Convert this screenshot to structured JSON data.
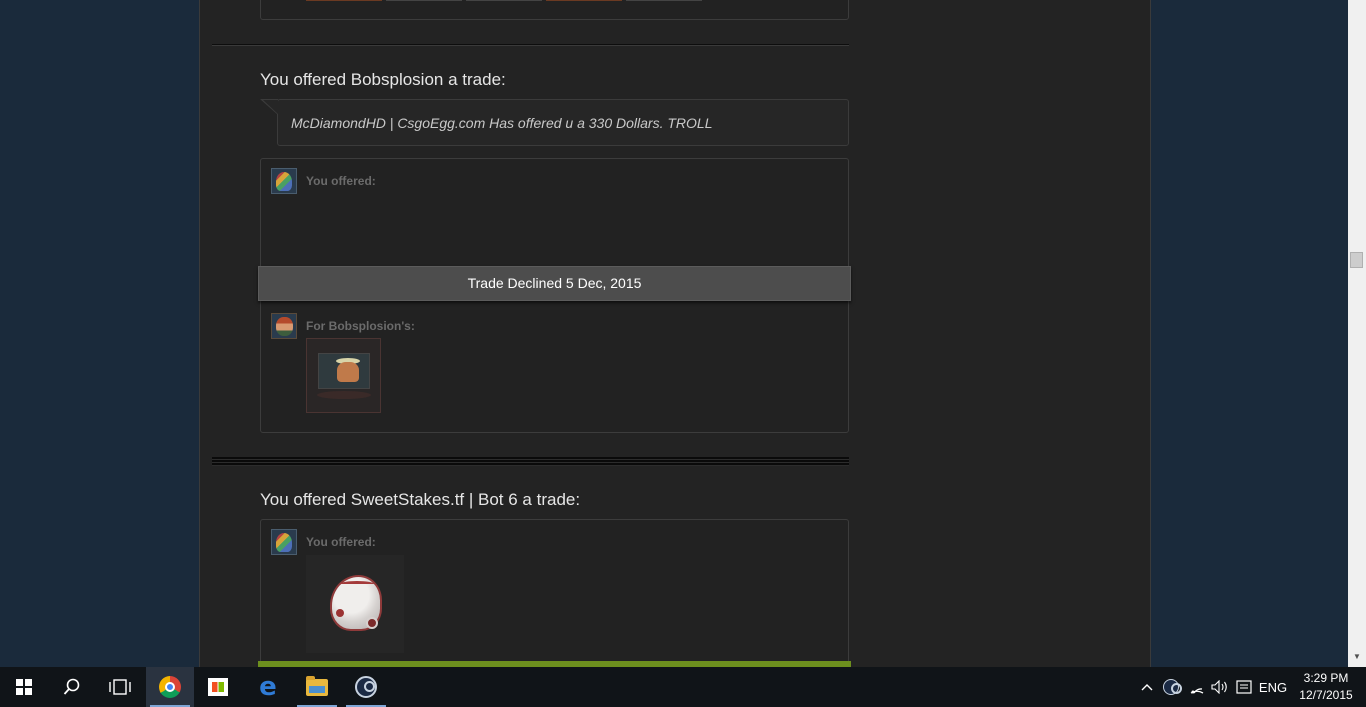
{
  "trades": [
    {
      "heading": "You offered Bobsplosion a trade:",
      "message": "McDiamondHD | CsgoEgg.com Has offered u a 330 Dollars. TROLL",
      "you_offered_label": "You offered:",
      "status": "Trade Declined 5 Dec, 2015",
      "for_label": "For Bobsplosion's:"
    },
    {
      "heading": "You offered SweetStakes.tf | Bot 6 a trade:",
      "you_offered_label": "You offered:"
    }
  ],
  "taskbar": {
    "apps": [
      "start-icon",
      "search-icon",
      "task-view-icon",
      "chrome-icon",
      "store-icon",
      "edge-icon",
      "file-explorer-icon",
      "steam-icon"
    ],
    "tray": {
      "language": "ENG",
      "time": "3:29 PM",
      "date": "12/7/2015"
    }
  }
}
